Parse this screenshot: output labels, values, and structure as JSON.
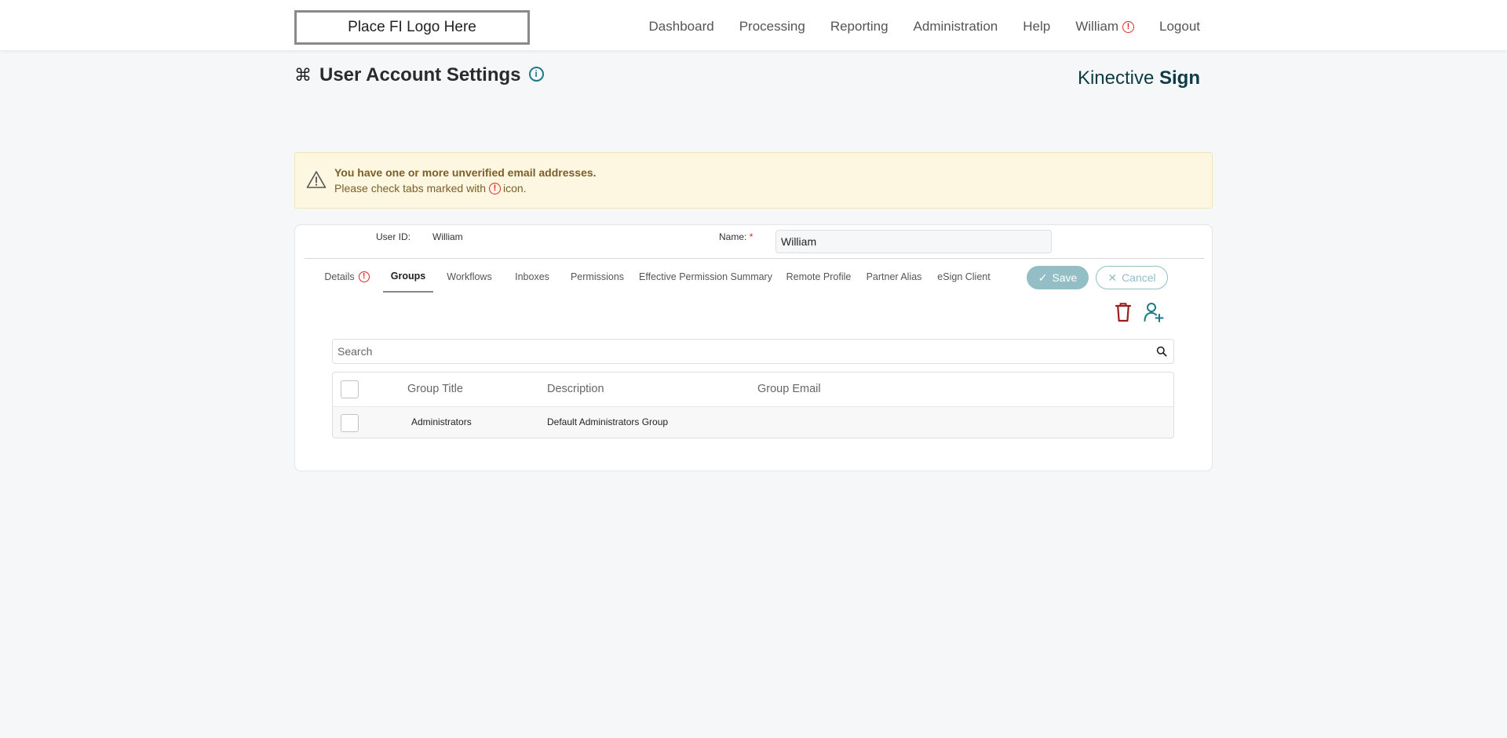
{
  "header": {
    "logo_text": "Place FI Logo Here",
    "nav": [
      "Dashboard",
      "Processing",
      "Reporting",
      "Administration",
      "Help",
      "William",
      "Logout"
    ]
  },
  "page": {
    "title": "User Account Settings",
    "brand_light": "Kinective",
    "brand_bold": "Sign"
  },
  "warning": {
    "title": "You have one or more unverified email addresses.",
    "text_before": "Please check tabs marked with",
    "text_after": "icon."
  },
  "user": {
    "id_label": "User ID:",
    "id_value": "William",
    "name_label": "Name:",
    "required_mark": "*",
    "name_value": "William"
  },
  "tabs": [
    {
      "label": "Details",
      "alert": true
    },
    {
      "label": "Groups",
      "active": true
    },
    {
      "label": "Workflows"
    },
    {
      "label": "Inboxes"
    },
    {
      "label": "Permissions"
    },
    {
      "label": "Effective Permission Summary"
    },
    {
      "label": "Remote Profile"
    },
    {
      "label": "Partner Alias"
    },
    {
      "label": "eSign Client"
    }
  ],
  "actions": {
    "save_label": "Save",
    "cancel_label": "Cancel"
  },
  "search": {
    "placeholder": "Search",
    "value": ""
  },
  "table": {
    "columns": [
      "Group Title",
      "Description",
      "Group Email"
    ],
    "rows": [
      {
        "title": "Administrators",
        "description": "Default Administrators Group",
        "email": ""
      }
    ]
  },
  "colors": {
    "accent": "#1a7a86",
    "alert": "#e02424",
    "delete": "#9b1c1c",
    "warning_bg": "#fdf6e1"
  }
}
